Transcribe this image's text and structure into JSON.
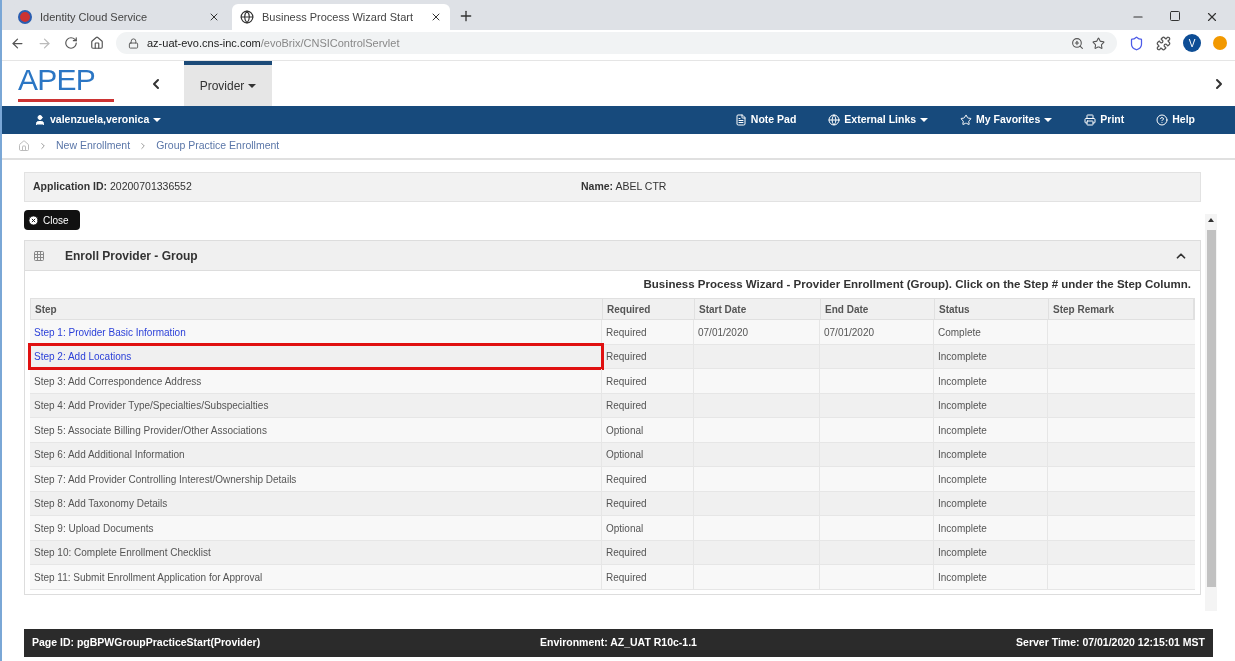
{
  "browser": {
    "tabs": [
      {
        "title": "Identity Cloud Service",
        "selected": false
      },
      {
        "title": "Business Process Wizard Start",
        "selected": true
      }
    ],
    "url_host": "az-uat-evo.cns-inc.com",
    "url_path": "/evoBrix/CNSIControlServlet",
    "profile_initial": "V"
  },
  "header": {
    "logo": "APEP",
    "menu": "Provider"
  },
  "navbar": {
    "user": "valenzuela,veronica",
    "links": [
      {
        "label": "Note Pad",
        "kind": "notepad",
        "dropdown": false
      },
      {
        "label": "External Links",
        "kind": "globe",
        "dropdown": true
      },
      {
        "label": "My Favorites",
        "kind": "star",
        "dropdown": true
      },
      {
        "label": "Print",
        "kind": "print",
        "dropdown": false
      },
      {
        "label": "Help",
        "kind": "help",
        "dropdown": false
      }
    ]
  },
  "breadcrumb": [
    "New Enrollment",
    "Group Practice Enrollment"
  ],
  "application": {
    "id_label": "Application ID:",
    "id_value": "20200701336552",
    "name_label": "Name:",
    "name_value": "ABEL CTR"
  },
  "close_button": "Close",
  "panel": {
    "title": "Enroll Provider - Group",
    "expanded": true,
    "caption": "Business Process Wizard - Provider Enrollment (Group). Click on the Step # under the Step Column."
  },
  "table": {
    "columns": [
      "Step",
      "Required",
      "Start Date",
      "End Date",
      "Status",
      "Step Remark"
    ],
    "rows": [
      {
        "step": "Step 1: Provider Basic Information",
        "linked": true,
        "highlighted": false,
        "required": "Required",
        "start": "07/01/2020",
        "end": "07/01/2020",
        "status": "Complete"
      },
      {
        "step": "Step 2: Add Locations",
        "linked": true,
        "highlighted": true,
        "required": "Required",
        "start": "",
        "end": "",
        "status": "Incomplete"
      },
      {
        "step": "Step 3: Add Correspondence Address",
        "linked": false,
        "highlighted": false,
        "required": "Required",
        "start": "",
        "end": "",
        "status": "Incomplete"
      },
      {
        "step": "Step 4: Add Provider Type/Specialties/Subspecialties",
        "linked": false,
        "highlighted": false,
        "required": "Required",
        "start": "",
        "end": "",
        "status": "Incomplete"
      },
      {
        "step": "Step 5: Associate Billing Provider/Other Associations",
        "linked": false,
        "highlighted": false,
        "required": "Optional",
        "start": "",
        "end": "",
        "status": "Incomplete"
      },
      {
        "step": "Step 6: Add Additional Information",
        "linked": false,
        "highlighted": false,
        "required": "Optional",
        "start": "",
        "end": "",
        "status": "Incomplete"
      },
      {
        "step": "Step 7: Add Provider Controlling Interest/Ownership Details",
        "linked": false,
        "highlighted": false,
        "required": "Required",
        "start": "",
        "end": "",
        "status": "Incomplete"
      },
      {
        "step": "Step 8: Add Taxonomy Details",
        "linked": false,
        "highlighted": false,
        "required": "Required",
        "start": "",
        "end": "",
        "status": "Incomplete"
      },
      {
        "step": "Step 9: Upload Documents",
        "linked": false,
        "highlighted": false,
        "required": "Optional",
        "start": "",
        "end": "",
        "status": "Incomplete"
      },
      {
        "step": "Step 10: Complete Enrollment Checklist",
        "linked": false,
        "highlighted": false,
        "required": "Required",
        "start": "",
        "end": "",
        "status": "Incomplete"
      },
      {
        "step": "Step 11: Submit Enrollment Application for Approval",
        "linked": false,
        "highlighted": false,
        "required": "Required",
        "start": "",
        "end": "",
        "status": "Incomplete"
      }
    ]
  },
  "footer": {
    "page_id": "Page ID: pgBPWGroupPracticeStart(Provider)",
    "environment": "Environment: AZ_UAT R10c-1.1",
    "server_time": "Server Time: 07/01/2020 12:15:01 MST"
  }
}
